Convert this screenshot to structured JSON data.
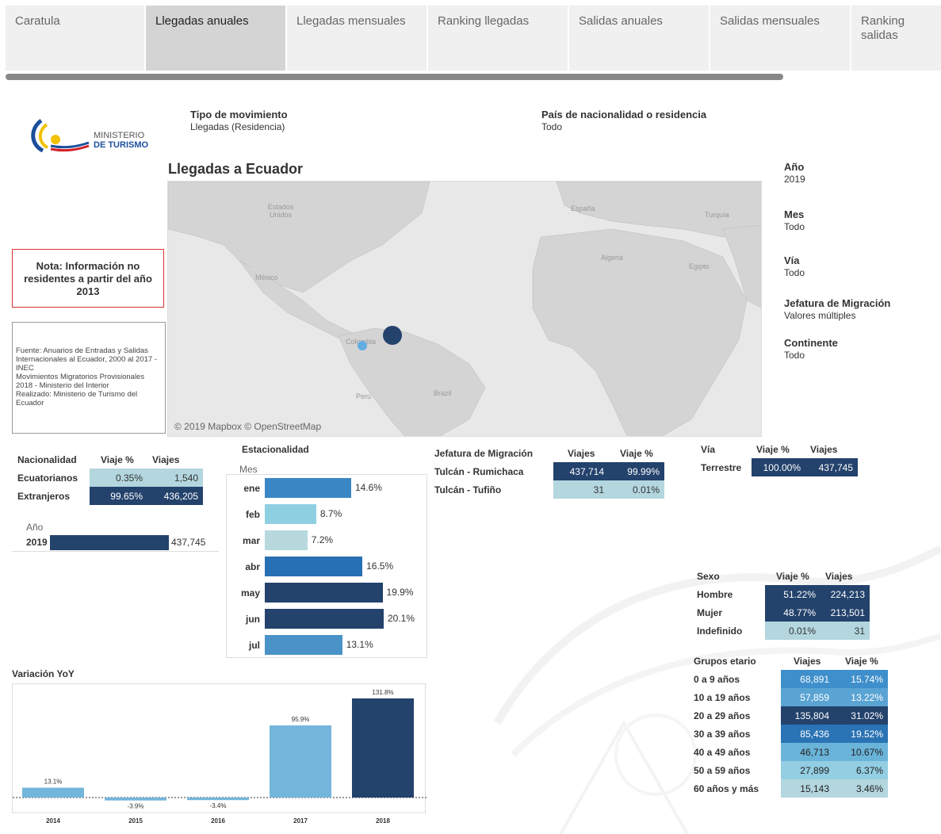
{
  "tabs": [
    {
      "label": "Caratula",
      "active": false
    },
    {
      "label": "Llegadas anuales",
      "active": true
    },
    {
      "label": "Llegadas mensuales",
      "active": false
    },
    {
      "label": "Ranking llegadas",
      "active": false
    },
    {
      "label": "Salidas anuales",
      "active": false
    },
    {
      "label": "Salidas mensuales",
      "active": false
    },
    {
      "label": "Ranking salidas",
      "active": false
    }
  ],
  "logo": {
    "line1": "MINISTERIO",
    "line2": "DE TURISMO"
  },
  "filters": {
    "tipo_movimiento": {
      "label": "Tipo de movimiento",
      "value": "Llegadas (Residencia)"
    },
    "pais": {
      "label": "País de nacionalidad o residencia",
      "value": "Todo"
    },
    "anio": {
      "label": "Año",
      "value": "2019"
    },
    "mes": {
      "label": "Mes",
      "value": "Todo"
    },
    "via": {
      "label": "Vía",
      "value": "Todo"
    },
    "jefatura": {
      "label": "Jefatura de Migración",
      "value": "Valores múltiples"
    },
    "continente": {
      "label": "Continente",
      "value": "Todo"
    }
  },
  "title": "Llegadas a Ecuador",
  "map": {
    "labels": [
      "Estados Unidos",
      "México",
      "Colombia",
      "Perú",
      "Brazil",
      "España",
      "Turquía",
      "Algeria",
      "Egipto"
    ],
    "credit": "© 2019 Mapbox © OpenStreetMap"
  },
  "note": "Nota: Información no residentes a partir del año 2013",
  "source_lines": [
    "Fuente: Anuarios de Entradas y Salidas Internacionales al Ecuador, 2000 al 2017 - INEC",
    "Movimientos Migratorios Provisionales 2018 - Ministerio del Interior",
    "Realizado: Ministerio de Turismo del Ecuador"
  ],
  "nacionalidad": {
    "headers": [
      "Nacionalidad",
      "Viaje %",
      "Viajes"
    ],
    "rows": [
      {
        "label": "Ecuatorianos",
        "pct": "0.35%",
        "viajes": "1,540",
        "color": "#b3d6df",
        "text": "#222"
      },
      {
        "label": "Extranjeros",
        "pct": "99.65%",
        "viajes": "436,205",
        "color": "#23426c",
        "text": "#fff"
      }
    ]
  },
  "anio_bar": {
    "header": "Año",
    "label": "2019",
    "value": "437,745",
    "fraction": 1.0
  },
  "estacionalidad": {
    "title": "Estacionalidad",
    "axis": "Mes",
    "rows": [
      {
        "mes": "ene",
        "pct": 14.6,
        "label": "14.6%",
        "color": "#3a87c5"
      },
      {
        "mes": "feb",
        "pct": 8.7,
        "label": "8.7%",
        "color": "#8ed0e2"
      },
      {
        "mes": "mar",
        "pct": 7.2,
        "label": "7.2%",
        "color": "#b7d9de"
      },
      {
        "mes": "abr",
        "pct": 16.5,
        "label": "16.5%",
        "color": "#2770b3"
      },
      {
        "mes": "may",
        "pct": 19.9,
        "label": "19.9%",
        "color": "#23426c"
      },
      {
        "mes": "jun",
        "pct": 20.1,
        "label": "20.1%",
        "color": "#23426c"
      },
      {
        "mes": "jul",
        "pct": 13.1,
        "label": "13.1%",
        "color": "#4a93c8"
      }
    ]
  },
  "jefatura_table": {
    "headers": [
      "Jefatura de Migración",
      "Viajes",
      "Viaje %"
    ],
    "rows": [
      {
        "label": "Tulcán - Rumichaca",
        "viajes": "437,714",
        "pct": "99.99%",
        "color": "#23426c",
        "text": "#fff"
      },
      {
        "label": "Tulcán - Tufiño",
        "viajes": "31",
        "pct": "0.01%",
        "color": "#b3d6df",
        "text": "#222"
      }
    ]
  },
  "via_table": {
    "headers": [
      "Vía",
      "Viaje %",
      "Viajes"
    ],
    "rows": [
      {
        "label": "Terrestre",
        "pct": "100.00%",
        "viajes": "437,745",
        "color": "#23426c",
        "text": "#fff"
      }
    ]
  },
  "sexo_table": {
    "headers": [
      "Sexo",
      "Viaje %",
      "Viajes"
    ],
    "rows": [
      {
        "label": "Hombre",
        "pct": "51.22%",
        "viajes": "224,213",
        "color": "#23426c",
        "text": "#fff"
      },
      {
        "label": "Mujer",
        "pct": "48.77%",
        "viajes": "213,501",
        "color": "#23426c",
        "text": "#fff"
      },
      {
        "label": "Indefinido",
        "pct": "0.01%",
        "viajes": "31",
        "color": "#b3d6df",
        "text": "#222"
      }
    ]
  },
  "edad_table": {
    "headers": [
      "Grupos etario",
      "Viajes",
      "Viaje %"
    ],
    "rows": [
      {
        "label": "0 a 9 años",
        "viajes": "68,891",
        "pct": "15.74%",
        "color": "#3e8fcb",
        "text": "#fff"
      },
      {
        "label": "10 a 19 años",
        "viajes": "57,859",
        "pct": "13.22%",
        "color": "#5aa4d4",
        "text": "#fff"
      },
      {
        "label": "20 a 29 años",
        "viajes": "135,804",
        "pct": "31.02%",
        "color": "#23426c",
        "text": "#fff"
      },
      {
        "label": "30 a 39 años",
        "viajes": "85,436",
        "pct": "19.52%",
        "color": "#2a73b4",
        "text": "#fff"
      },
      {
        "label": "40 a 49 años",
        "viajes": "46,713",
        "pct": "10.67%",
        "color": "#6ab3d9",
        "text": "#222"
      },
      {
        "label": "50 a 59 años",
        "viajes": "27,899",
        "pct": "6.37%",
        "color": "#93cee2",
        "text": "#222"
      },
      {
        "label": "60 años y más",
        "viajes": "15,143",
        "pct": "3.46%",
        "color": "#b3d6df",
        "text": "#222"
      }
    ]
  },
  "chart_data": {
    "type": "bar",
    "title": "Variación YoY",
    "categories": [
      "2014",
      "2015",
      "2016",
      "2017",
      "2018"
    ],
    "values": [
      13.1,
      -3.9,
      -3.4,
      95.9,
      131.8
    ],
    "data_labels": [
      "13.1%",
      "-3.9%",
      "-3.4%",
      "95.9%",
      "131.8%"
    ],
    "colors": [
      "#74b6db",
      "#74b6db",
      "#74b6db",
      "#74b6db",
      "#23426c"
    ],
    "xlabel": "",
    "ylabel": "",
    "grid": false
  }
}
